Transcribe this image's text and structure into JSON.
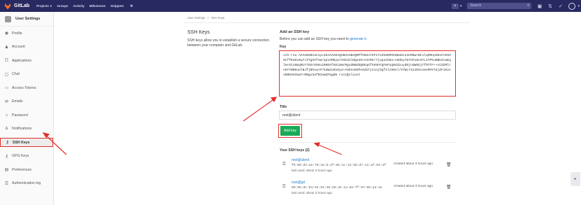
{
  "header": {
    "brand": "GitLab",
    "nav": [
      "Projects ∨",
      "Groups",
      "Activity",
      "Milestones",
      "Snippets"
    ],
    "search_placeholder": "Search"
  },
  "sidebar": {
    "title": "User Settings",
    "items": [
      {
        "label": "Profile",
        "icon": "profile-icon",
        "glyph": "◉"
      },
      {
        "label": "Account",
        "icon": "account-icon",
        "glyph": "♟"
      },
      {
        "label": "Applications",
        "icon": "applications-icon",
        "glyph": "☷"
      },
      {
        "label": "Chat",
        "icon": "chat-icon",
        "glyph": "▢"
      },
      {
        "label": "Access Tokens",
        "icon": "token-icon",
        "glyph": "▭"
      },
      {
        "label": "Emails",
        "icon": "email-icon",
        "glyph": "✉"
      },
      {
        "label": "Password",
        "icon": "lock-icon",
        "glyph": "⌂"
      },
      {
        "label": "Notifications",
        "icon": "bell-icon",
        "glyph": "∆"
      },
      {
        "label": "SSH Keys",
        "icon": "key-icon",
        "glyph": "⚷"
      },
      {
        "label": "GPG Keys",
        "icon": "gpg-key-icon",
        "glyph": "⚷"
      },
      {
        "label": "Preferences",
        "icon": "preferences-icon",
        "glyph": "▤"
      },
      {
        "label": "Authentication log",
        "icon": "log-icon",
        "glyph": "☰"
      }
    ],
    "active_index": 8
  },
  "breadcrumb": {
    "parent": "User Settings",
    "sep": ">",
    "current": "SSH Keys"
  },
  "page": {
    "title": "SSH Keys",
    "description": "SSH keys allow you to establish a secure connection between your computer and GitLab."
  },
  "form": {
    "heading": "Add an SSH key",
    "intro_text": "Before you can add an SSH key you need to",
    "intro_link": "generate it.",
    "key_label": "Key",
    "key_value": "ssh-rsa AAAAB3NzaC1yc2EAAAADAQABAAABAQDPfS8UoYSF17sZk8KMVk8WuOcu3eM6wrWt1lqHRnpS0xCYE5SStffEU5vZw7/ZTgSVfsW/q2xSM0yU/VeEd1lDQe39+A3YRX/7jupazb8u+sHHby767VFo8n4TLIYPkuDBUIcwEqlm+kCo6mqMLF7OSr5O6uiRHDAfeDimmrMgodNW2DQ8EqGfXHSH7gFmFaqN4d1oyd0jnUW6GjTfOTTF++cCdZMlrnHY7WN6uUlNJfjNhvq+P/kZW2o01Dya+ASOsvWIPeXZGTjeinjOqf4lzSNvl/X7WL71e1DSss8oMVV7djZF1KzovN9KHVX5wY+RNgx34fDCHwUF6g8N root@client",
    "title_label": "Title",
    "title_value": "root@client",
    "submit": "Add key"
  },
  "your_keys": {
    "heading": "Your SSH keys (2)",
    "keys": [
      {
        "title": "root@client",
        "fingerprint": "f9:08:d2:ae:79:4a:b:2f:85:1c:22:56:d7:11:af:04:4f",
        "last_used": "last used: about 3 hours ago",
        "created": "created about 3 hours ago"
      },
      {
        "title": "root@git",
        "fingerprint": "69:96:dc:01:64:53:48:26:de:1a:8e:ff:57:06:a3:4a",
        "last_used": "last used: about 3 hours ago",
        "created": "created about 3 hours ago"
      }
    ]
  },
  "colors": {
    "topbar": "#292961",
    "annotation": "#e0302b",
    "primary_button": "#1aaa55",
    "link": "#1f78d1"
  }
}
